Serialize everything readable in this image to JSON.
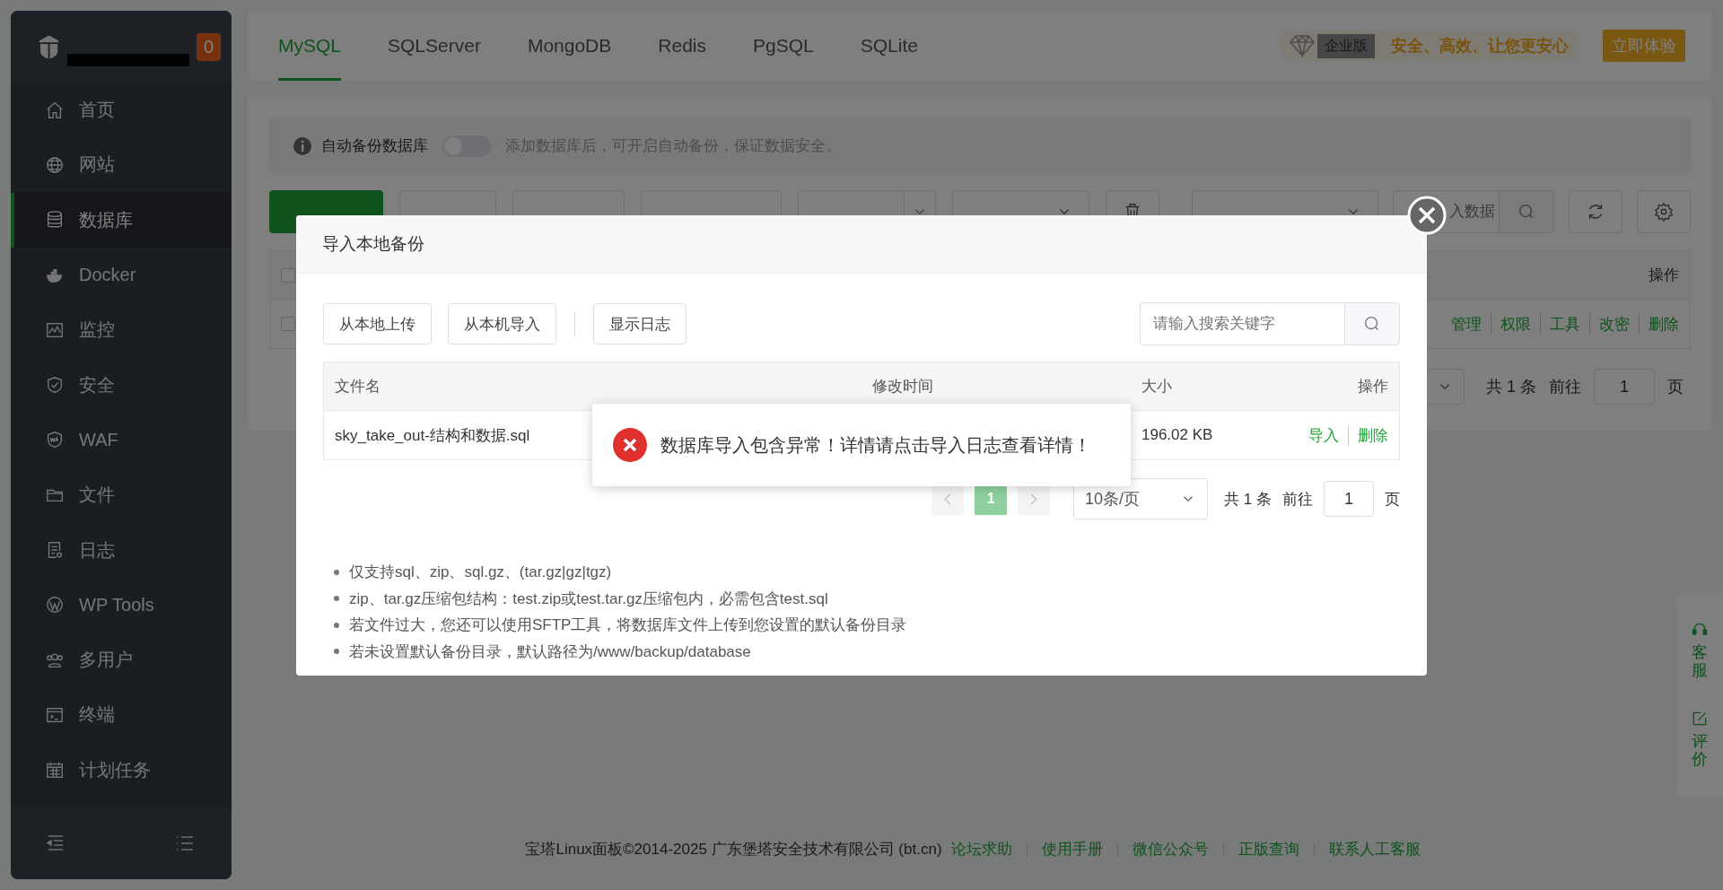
{
  "sidebar": {
    "badge": "0",
    "items": [
      {
        "label": "首页",
        "selected": false
      },
      {
        "label": "网站",
        "selected": false
      },
      {
        "label": "数据库",
        "selected": true
      },
      {
        "label": "Docker",
        "selected": false
      },
      {
        "label": "监控",
        "selected": false
      },
      {
        "label": "安全",
        "selected": false
      },
      {
        "label": "WAF",
        "selected": false
      },
      {
        "label": "文件",
        "selected": false
      },
      {
        "label": "日志",
        "selected": false
      },
      {
        "label": "WP Tools",
        "selected": false
      },
      {
        "label": "多用户",
        "selected": false
      },
      {
        "label": "终端",
        "selected": false
      },
      {
        "label": "计划任务",
        "selected": false
      }
    ]
  },
  "db_tabs": [
    {
      "label": "MySQL",
      "selected": true
    },
    {
      "label": "SQLServer",
      "selected": false
    },
    {
      "label": "MongoDB",
      "selected": false
    },
    {
      "label": "Redis",
      "selected": false
    },
    {
      "label": "PgSQL",
      "selected": false
    },
    {
      "label": "SQLite",
      "selected": false
    }
  ],
  "promo": {
    "badge": "企业版",
    "slogan": "安全、高效、让您更安心",
    "button": "立即体验"
  },
  "auto_backup": {
    "label": "自动备份数据库",
    "on": false,
    "hint": "添加数据库后，可开启自动备份，保证数据安全。"
  },
  "toolbar": {
    "search_placeholder": "入数据"
  },
  "db_table": {
    "action_header": "操作",
    "header_checked": false,
    "row_checked": false,
    "row_actions": [
      "管理",
      "权限",
      "工具",
      "改密",
      "删除"
    ]
  },
  "db_pager": {
    "total": "共 1 条",
    "goto": "前往",
    "page": "1",
    "unit": "页"
  },
  "footer": {
    "copyright": "宝塔Linux面板©2014-2025 广东堡塔安全技术有限公司 (bt.cn)",
    "links": [
      "论坛求助",
      "使用手册",
      "微信公众号",
      "正版查询",
      "联系人工客服"
    ]
  },
  "float_panel": [
    "客服",
    "评价"
  ],
  "dialog": {
    "title": "导入本地备份",
    "buttons": [
      "从本地上传",
      "从本机导入",
      "显示日志"
    ],
    "search_placeholder": "请输入搜索关键字",
    "columns": [
      "文件名",
      "修改时间",
      "大小",
      "操作"
    ],
    "rows": [
      {
        "name": "sky_take_out-结构和数据.sql",
        "size": "196.02 KB",
        "actions": [
          "导入",
          "删除"
        ]
      }
    ],
    "pager": {
      "pages": [
        {
          "label": "1",
          "selected": true
        }
      ],
      "page_size": "10条/页",
      "total": "共 1 条",
      "goto": "前往",
      "page": "1",
      "unit": "页"
    },
    "notes": [
      "仅支持sql、zip、sql.gz、(tar.gz|gz|tgz)",
      "zip、tar.gz压缩包结构：test.zip或test.tar.gz压缩包内，必需包含test.sql",
      "若文件过大，您还可以使用SFTP工具，将数据库文件上传到您设置的默认备份目录",
      "若未设置默认备份目录，默认路径为/www/backup/database"
    ]
  },
  "toast": {
    "message": "数据库导入包含异常！详情请点击导入日志查看详情！"
  }
}
